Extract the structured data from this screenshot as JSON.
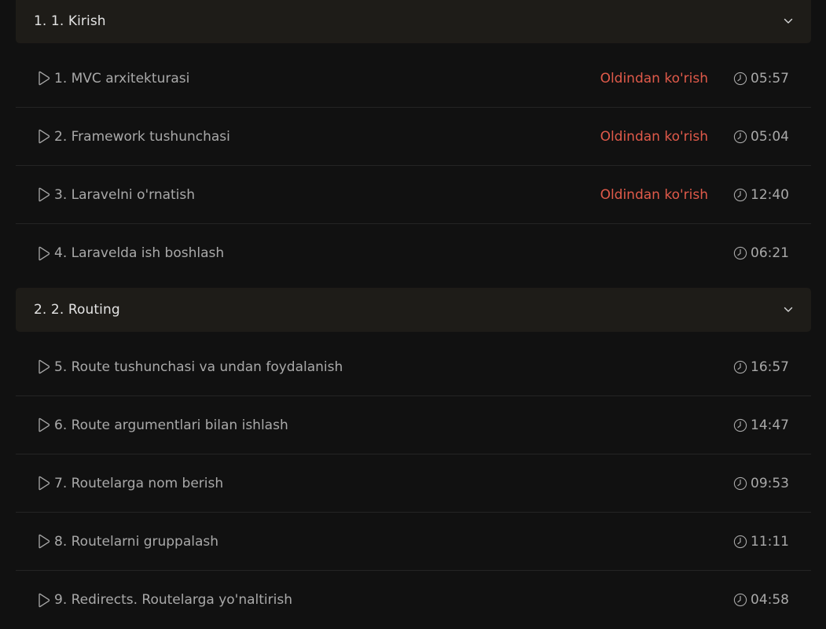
{
  "sections": [
    {
      "title": "1. 1. Kirish",
      "lessons": [
        {
          "title": "1. MVC arxitekturasi",
          "preview": "Oldindan ko'rish",
          "duration": "05:57"
        },
        {
          "title": "2. Framework tushunchasi",
          "preview": "Oldindan ko'rish",
          "duration": "05:04"
        },
        {
          "title": "3. Laravelni o'rnatish",
          "preview": "Oldindan ko'rish",
          "duration": "12:40"
        },
        {
          "title": "4. Laravelda ish boshlash",
          "preview": "",
          "duration": "06:21"
        }
      ]
    },
    {
      "title": "2. 2. Routing",
      "lessons": [
        {
          "title": "5. Route tushunchasi va undan foydalanish",
          "preview": "",
          "duration": "16:57"
        },
        {
          "title": "6. Route argumentlari bilan ishlash",
          "preview": "",
          "duration": "14:47"
        },
        {
          "title": "7. Routelarga nom berish",
          "preview": "",
          "duration": "09:53"
        },
        {
          "title": "8. Routelarni gruppalash",
          "preview": "",
          "duration": "11:11"
        },
        {
          "title": "9. Redirects. Routelarga yo'naltirish",
          "preview": "",
          "duration": "04:58"
        }
      ]
    }
  ],
  "icons": {
    "play": "play-icon",
    "clock": "clock-icon",
    "chevron": "chevron-down-icon"
  },
  "colors": {
    "background": "#111111",
    "section_header": "#1e1c18",
    "preview": "#e05a4a",
    "text": "#a9a9a9"
  }
}
